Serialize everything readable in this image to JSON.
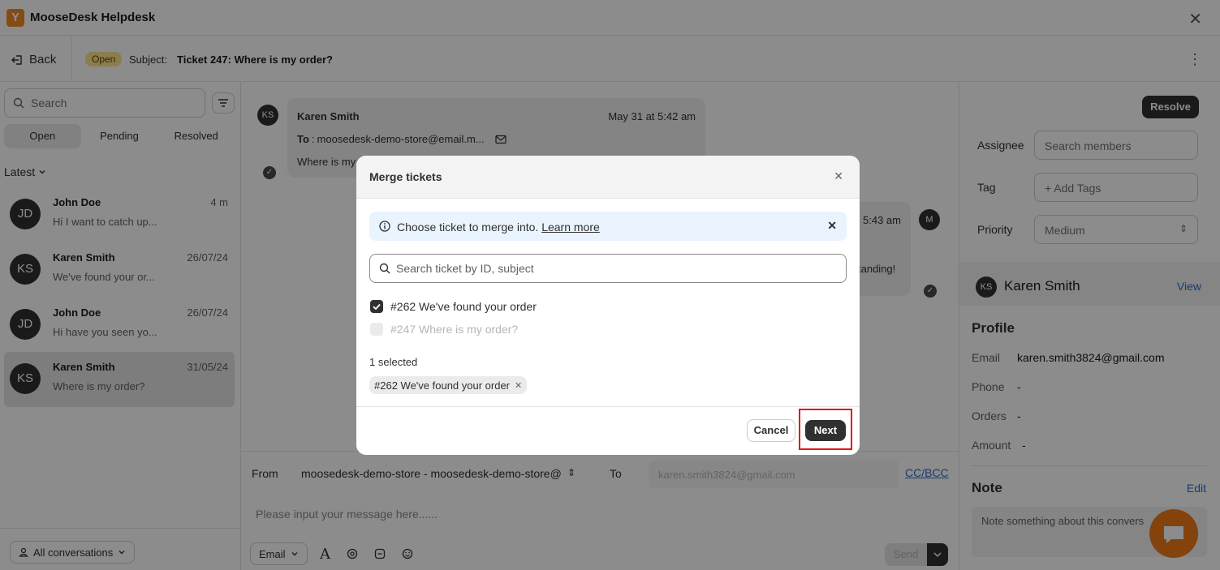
{
  "app": {
    "title": "MooseDesk Helpdesk",
    "logo_letter": "Y"
  },
  "header": {
    "back_label": "Back",
    "status_badge": "Open",
    "subject_label": "Subject:",
    "subject_value": "Ticket 247: Where is my order?"
  },
  "sidebar": {
    "search_placeholder": "Search",
    "tabs": [
      "Open",
      "Pending",
      "Resolved"
    ],
    "active_tab": "Open",
    "sort_label": "Latest",
    "conversations": [
      {
        "initials": "JD",
        "name": "John Doe",
        "time": "4 m",
        "preview": "Hi I want to catch up..."
      },
      {
        "initials": "KS",
        "name": "Karen Smith",
        "time": "26/07/24",
        "preview": "We've found your or..."
      },
      {
        "initials": "JD",
        "name": "John Doe",
        "time": "26/07/24",
        "preview": "Hi have you seen yo..."
      },
      {
        "initials": "KS",
        "name": "Karen Smith",
        "time": "31/05/24",
        "preview": "Where is my order?"
      }
    ],
    "footer_filter": "All conversations"
  },
  "chat": {
    "message1": {
      "initials": "KS",
      "sender": "Karen Smith",
      "time": "May 31 at 5:42 am",
      "to_label": "To",
      "to_value": "moosedesk-demo-store@email.m...",
      "body": "Where is my"
    },
    "message2": {
      "initials": "M",
      "time_fragment": "5:43 am",
      "body_fragment": "tanding!"
    }
  },
  "composer": {
    "from_label": "From",
    "from_value": "moosedesk-demo-store - moosedesk-demo-store@",
    "to_label": "To",
    "to_value": "karen.smith3824@gmail.com",
    "ccbcc": "CC/BCC",
    "message_placeholder": "Please input your message here......",
    "channel": "Email",
    "send_label": "Send"
  },
  "right_panel": {
    "resolve_label": "Resolve",
    "assignee_label": "Assignee",
    "assignee_placeholder": "Search members",
    "tag_label": "Tag",
    "tag_placeholder": "+ Add Tags",
    "priority_label": "Priority",
    "priority_value": "Medium",
    "contact": {
      "initials": "KS",
      "name": "Karen Smith",
      "view_label": "View"
    },
    "profile_heading": "Profile",
    "profile": [
      {
        "key": "Email",
        "value": "karen.smith3824@gmail.com"
      },
      {
        "key": "Phone",
        "value": "-"
      },
      {
        "key": "Orders",
        "value": "-"
      },
      {
        "key": "Amount",
        "value": "-"
      }
    ],
    "note_heading": "Note",
    "note_edit": "Edit",
    "note_placeholder": "Note something about this convers"
  },
  "modal": {
    "title": "Merge tickets",
    "banner_text": "Choose ticket to merge into.",
    "banner_link": "Learn more",
    "search_placeholder": "Search ticket by ID, subject",
    "options": [
      {
        "label": "#262 We've found your order",
        "checked": true,
        "disabled": false
      },
      {
        "label": "#247 Where is my order?",
        "checked": false,
        "disabled": true
      }
    ],
    "selected_count": "1 selected",
    "selected_chip": "#262 We've found your order",
    "cancel_label": "Cancel",
    "next_label": "Next"
  },
  "colors": {
    "accent_orange": "#f07a17",
    "badge_yellow": "#ffe58a",
    "primary_dark": "#303030",
    "link_blue": "#2c6ecb",
    "highlight_red": "#e0161b"
  }
}
